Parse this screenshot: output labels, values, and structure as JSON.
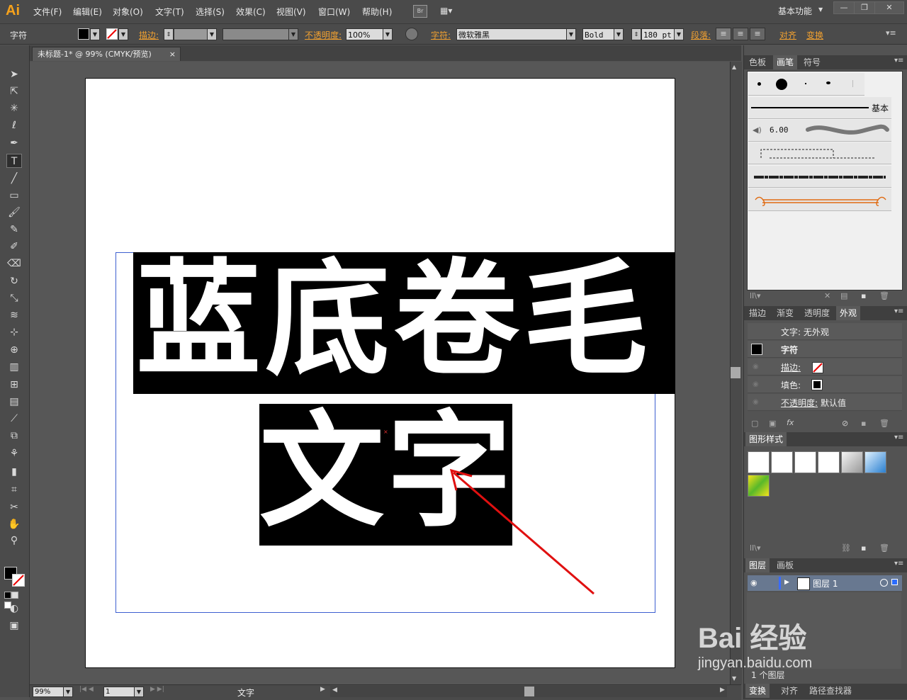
{
  "app": {
    "logo": "Ai"
  },
  "menu": [
    "文件(F)",
    "编辑(E)",
    "对象(O)",
    "文字(T)",
    "选择(S)",
    "效果(C)",
    "视图(V)",
    "窗口(W)",
    "帮助(H)"
  ],
  "bridge_label": "Br",
  "workspace": "基本功能",
  "window_buttons": [
    "—",
    "❐",
    "✕"
  ],
  "control": {
    "mode_label": "字符",
    "stroke_label": "描边:",
    "opacity_label": "不透明度:",
    "opacity_value": "100%",
    "char_label": "字符:",
    "font_name": "微软雅黑",
    "font_style": "Bold",
    "font_size": "180 pt",
    "para_label": "段落:",
    "align_label": "对齐",
    "transform_label": "变换"
  },
  "document": {
    "tab_title": "未标题-1* @ 99% (CMYK/预览)",
    "close": "×",
    "text_line1": "蓝底卷毛",
    "text_line2": "文字"
  },
  "status": {
    "zoom": "99%",
    "page": "1",
    "tool": "文字"
  },
  "brush_panel": {
    "tabs": [
      "色板",
      "画笔",
      "符号"
    ],
    "active_tab": "画笔",
    "basic_label": "基本",
    "calligraphic_size": "6.00"
  },
  "appearance_panel": {
    "tabs": [
      "描边",
      "渐变",
      "透明度",
      "外观"
    ],
    "active_tab": "外观",
    "header": "文字: 无外观",
    "object": "字符",
    "stroke_label": "描边:",
    "fill_label": "填色:",
    "opacity_label": "不透明度:",
    "opacity_value": "默认值",
    "fx_label": "fx"
  },
  "graphic_styles_panel": {
    "title": "图形样式"
  },
  "layers_panel": {
    "tabs": [
      "图层",
      "画板"
    ],
    "active_tab": "图层",
    "layer_name": "图层 1",
    "count_label": "1 个图层"
  },
  "bottom_tabs": [
    "变换",
    "对齐",
    "路径查找器"
  ],
  "watermark": {
    "brand": "Bai 经验",
    "url": "jingyan.baidu.com"
  },
  "colors": {
    "highlight": "#000000",
    "text": "#ffffff",
    "arrow": "#e01010",
    "frame": "#3d5fd0",
    "accent": "#f0a030"
  }
}
